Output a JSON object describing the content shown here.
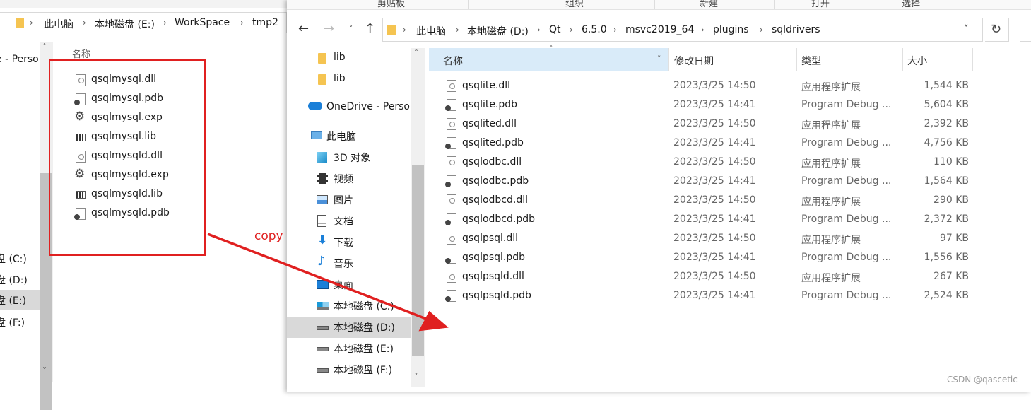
{
  "ribbon": {
    "groups": [
      "剪贴板",
      "组织",
      "新建",
      "打开",
      "选择"
    ]
  },
  "left_window": {
    "breadcrumb": [
      "此电脑",
      "本地磁盘 (E:)",
      "WorkSpace",
      "tmp2"
    ],
    "nav_items": [
      "e - Perso",
      "盘 (C:)",
      "盘 (D:)",
      "盘 (E:)",
      "盘 (F:)"
    ],
    "column_name": "名称",
    "files": [
      {
        "name": "qsqlmysql.dll",
        "type": "dll"
      },
      {
        "name": "qsqlmysql.pdb",
        "type": "pdb"
      },
      {
        "name": "qsqlmysql.exp",
        "type": "exp"
      },
      {
        "name": "qsqlmysql.lib",
        "type": "lib"
      },
      {
        "name": "qsqlmysqld.dll",
        "type": "dll"
      },
      {
        "name": "qsqlmysqld.exp",
        "type": "exp"
      },
      {
        "name": "qsqlmysqld.lib",
        "type": "lib"
      },
      {
        "name": "qsqlmysqld.pdb",
        "type": "pdb"
      }
    ]
  },
  "annotation": {
    "label": "copy",
    "color": "#e02020"
  },
  "right_window": {
    "breadcrumb": [
      "此电脑",
      "本地磁盘 (D:)",
      "Qt",
      "6.5.0",
      "msvc2019_64",
      "plugins",
      "sqldrivers"
    ],
    "nav_items": [
      {
        "label": "lib",
        "icon": "folder-icon"
      },
      {
        "label": "lib",
        "icon": "folder-icon"
      },
      {
        "label": "OneDrive - Perso",
        "icon": "cloud-icon"
      },
      {
        "label": "此电脑",
        "icon": "computer-icon"
      },
      {
        "label": "3D 对象",
        "icon": "cube-icon"
      },
      {
        "label": "视频",
        "icon": "video-icon"
      },
      {
        "label": "图片",
        "icon": "picture-icon"
      },
      {
        "label": "文档",
        "icon": "document-icon"
      },
      {
        "label": "下载",
        "icon": "download-icon"
      },
      {
        "label": "音乐",
        "icon": "music-icon"
      },
      {
        "label": "桌面",
        "icon": "desktop-icon"
      },
      {
        "label": "本地磁盘 (C:)",
        "icon": "windows-drive-icon"
      },
      {
        "label": "本地磁盘 (D:)",
        "icon": "drive-icon"
      },
      {
        "label": "本地磁盘 (E:)",
        "icon": "drive-icon"
      },
      {
        "label": "本地磁盘 (F:)",
        "icon": "drive-icon"
      }
    ],
    "columns": {
      "name": "名称",
      "date": "修改日期",
      "type": "类型",
      "size": "大小"
    },
    "files": [
      {
        "name": "qsqlite.dll",
        "date": "2023/3/25 14:50",
        "type": "应用程序扩展",
        "size": "1,544 KB",
        "icon": "dll"
      },
      {
        "name": "qsqlite.pdb",
        "date": "2023/3/25 14:41",
        "type": "Program Debug ...",
        "size": "5,604 KB",
        "icon": "pdb"
      },
      {
        "name": "qsqlited.dll",
        "date": "2023/3/25 14:50",
        "type": "应用程序扩展",
        "size": "2,392 KB",
        "icon": "dll"
      },
      {
        "name": "qsqlited.pdb",
        "date": "2023/3/25 14:41",
        "type": "Program Debug ...",
        "size": "4,756 KB",
        "icon": "pdb"
      },
      {
        "name": "qsqlodbc.dll",
        "date": "2023/3/25 14:50",
        "type": "应用程序扩展",
        "size": "110 KB",
        "icon": "dll"
      },
      {
        "name": "qsqlodbc.pdb",
        "date": "2023/3/25 14:41",
        "type": "Program Debug ...",
        "size": "1,564 KB",
        "icon": "pdb"
      },
      {
        "name": "qsqlodbcd.dll",
        "date": "2023/3/25 14:50",
        "type": "应用程序扩展",
        "size": "290 KB",
        "icon": "dll"
      },
      {
        "name": "qsqlodbcd.pdb",
        "date": "2023/3/25 14:41",
        "type": "Program Debug ...",
        "size": "2,372 KB",
        "icon": "pdb"
      },
      {
        "name": "qsqlpsql.dll",
        "date": "2023/3/25 14:50",
        "type": "应用程序扩展",
        "size": "97 KB",
        "icon": "dll"
      },
      {
        "name": "qsqlpsql.pdb",
        "date": "2023/3/25 14:41",
        "type": "Program Debug ...",
        "size": "1,556 KB",
        "icon": "pdb"
      },
      {
        "name": "qsqlpsqld.dll",
        "date": "2023/3/25 14:50",
        "type": "应用程序扩展",
        "size": "267 KB",
        "icon": "dll"
      },
      {
        "name": "qsqlpsqld.pdb",
        "date": "2023/3/25 14:41",
        "type": "Program Debug ...",
        "size": "2,524 KB",
        "icon": "pdb"
      }
    ]
  },
  "watermark": "CSDN @qascetic"
}
